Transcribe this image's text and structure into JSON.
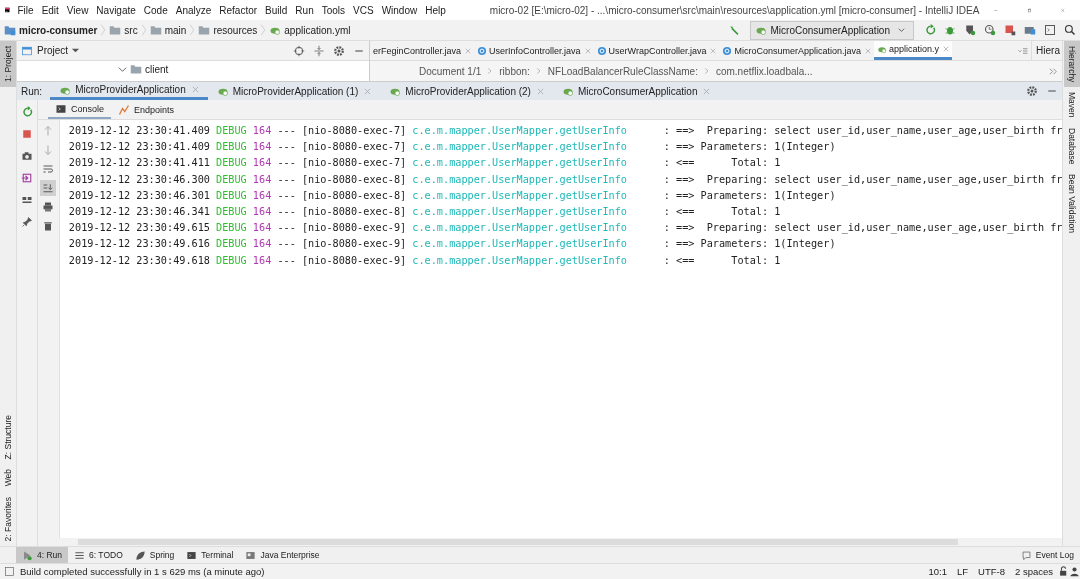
{
  "menu": [
    "File",
    "Edit",
    "View",
    "Navigate",
    "Code",
    "Analyze",
    "Refactor",
    "Build",
    "Run",
    "Tools",
    "VCS",
    "Window",
    "Help"
  ],
  "window": {
    "title": "micro-02 [E:\\micro-02] - ...\\micro-consumer\\src\\main\\resources\\application.yml [micro-consumer] - IntelliJ IDEA"
  },
  "navbar": {
    "breadcrumbs": [
      {
        "label": "micro-consumer",
        "kind": "module"
      },
      {
        "label": "src",
        "kind": "folder"
      },
      {
        "label": "main",
        "kind": "folder"
      },
      {
        "label": "resources",
        "kind": "resources"
      },
      {
        "label": "application.yml",
        "kind": "file"
      }
    ],
    "run_config": "MicroConsumerApplication"
  },
  "left_tools_top": [
    {
      "label": "1: Project",
      "selected": true
    }
  ],
  "left_tools_bottom": [
    {
      "label": "Z: Structure",
      "selected": false
    },
    {
      "label": "Web",
      "selected": false
    },
    {
      "label": "2: Favorites",
      "selected": false
    }
  ],
  "right_tools": [
    {
      "label": "Hierarchy",
      "selected": true
    },
    {
      "label": "Maven",
      "selected": false
    },
    {
      "label": "Database",
      "selected": false
    },
    {
      "label": "Bean Validation",
      "selected": false
    }
  ],
  "project_panel": {
    "title": "Project",
    "tree": [
      {
        "label": "client",
        "expanded": true
      }
    ]
  },
  "editor_tabs": [
    {
      "label": "erFeginController.java",
      "kind": "plain",
      "selected": false
    },
    {
      "label": "UserInfoController.java",
      "kind": "class",
      "selected": false
    },
    {
      "label": "UserWrapController.java",
      "kind": "class",
      "selected": false
    },
    {
      "label": "MicroConsumerApplication.java",
      "kind": "app",
      "selected": false
    },
    {
      "label": "application.y",
      "kind": "yml",
      "selected": true
    }
  ],
  "hierarchy_panel_title": "Hiera",
  "editor_breadcrumbs": [
    "Document 1/1",
    "ribbon:",
    "NFLoadBalancerRuleClassName:",
    "com.netflix.loadbala..."
  ],
  "run_panel": {
    "label": "Run:",
    "tabs": [
      {
        "label": "MicroProviderApplication",
        "selected": true
      },
      {
        "label": "MicroProviderApplication (1)",
        "selected": false
      },
      {
        "label": "MicroProviderApplication (2)",
        "selected": false
      },
      {
        "label": "MicroConsumerApplication",
        "selected": false
      }
    ],
    "subtabs": [
      {
        "label": "Console",
        "kind": "console",
        "selected": true
      },
      {
        "label": "Endpoints",
        "kind": "endpoints",
        "selected": false
      }
    ],
    "log": [
      {
        "timestamp": "2019-12-12 23:30:41.409",
        "level": "DEBUG",
        "pid": "164",
        "sep": "---",
        "thread": "[nio-8080-exec-7]",
        "logger": "c.e.m.mapper.UserMapper.getUserInfo",
        "message": ": ==>  Preparing: select user_id,user_name,user_age,user_birth fr"
      },
      {
        "timestamp": "2019-12-12 23:30:41.409",
        "level": "DEBUG",
        "pid": "164",
        "sep": "---",
        "thread": "[nio-8080-exec-7]",
        "logger": "c.e.m.mapper.UserMapper.getUserInfo",
        "message": ": ==> Parameters: 1(Integer)"
      },
      {
        "timestamp": "2019-12-12 23:30:41.411",
        "level": "DEBUG",
        "pid": "164",
        "sep": "---",
        "thread": "[nio-8080-exec-7]",
        "logger": "c.e.m.mapper.UserMapper.getUserInfo",
        "message": ": <==      Total: 1"
      },
      {
        "timestamp": "2019-12-12 23:30:46.300",
        "level": "DEBUG",
        "pid": "164",
        "sep": "---",
        "thread": "[nio-8080-exec-8]",
        "logger": "c.e.m.mapper.UserMapper.getUserInfo",
        "message": ": ==>  Preparing: select user_id,user_name,user_age,user_birth fr"
      },
      {
        "timestamp": "2019-12-12 23:30:46.301",
        "level": "DEBUG",
        "pid": "164",
        "sep": "---",
        "thread": "[nio-8080-exec-8]",
        "logger": "c.e.m.mapper.UserMapper.getUserInfo",
        "message": ": ==> Parameters: 1(Integer)"
      },
      {
        "timestamp": "2019-12-12 23:30:46.341",
        "level": "DEBUG",
        "pid": "164",
        "sep": "---",
        "thread": "[nio-8080-exec-8]",
        "logger": "c.e.m.mapper.UserMapper.getUserInfo",
        "message": ": <==      Total: 1"
      },
      {
        "timestamp": "2019-12-12 23:30:49.615",
        "level": "DEBUG",
        "pid": "164",
        "sep": "---",
        "thread": "[nio-8080-exec-9]",
        "logger": "c.e.m.mapper.UserMapper.getUserInfo",
        "message": ": ==>  Preparing: select user_id,user_name,user_age,user_birth fr"
      },
      {
        "timestamp": "2019-12-12 23:30:49.616",
        "level": "DEBUG",
        "pid": "164",
        "sep": "---",
        "thread": "[nio-8080-exec-9]",
        "logger": "c.e.m.mapper.UserMapper.getUserInfo",
        "message": ": ==> Parameters: 1(Integer)"
      },
      {
        "timestamp": "2019-12-12 23:30:49.618",
        "level": "DEBUG",
        "pid": "164",
        "sep": "---",
        "thread": "[nio-8080-exec-9]",
        "logger": "c.e.m.mapper.UserMapper.getUserInfo",
        "message": ": <==      Total: 1"
      }
    ]
  },
  "bottom_tools": [
    {
      "label": "4: Run",
      "kind": "run",
      "selected": true
    },
    {
      "label": "6: TODO",
      "kind": "todo",
      "selected": false
    },
    {
      "label": "Spring",
      "kind": "spring",
      "selected": false
    },
    {
      "label": "Terminal",
      "kind": "terminal",
      "selected": false
    },
    {
      "label": "Java Enterprise",
      "kind": "enterprise",
      "selected": false
    }
  ],
  "event_log": "Event Log",
  "status_bar": {
    "message": "Build completed successfully in 1 s 629 ms (a minute ago)",
    "position": "10:1",
    "line_separator": "LF",
    "encoding": "UTF-8",
    "indent": "2 spaces"
  }
}
